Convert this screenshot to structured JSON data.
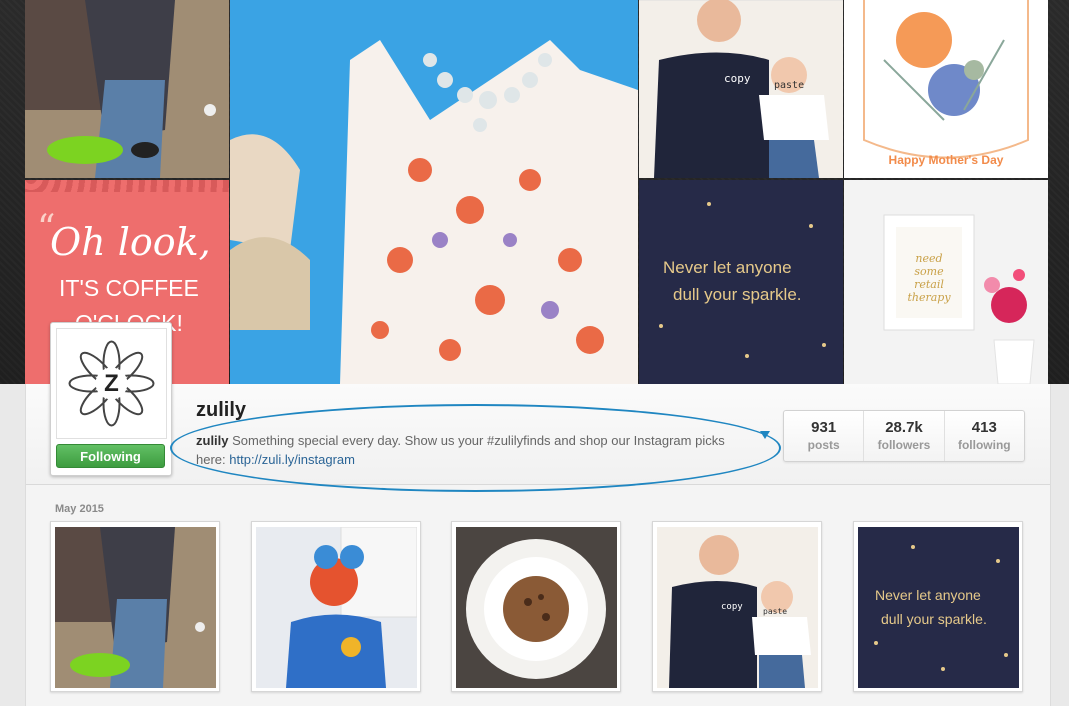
{
  "hero": {
    "coffee_line1": "Oh look,",
    "coffee_line2": "IT'S COFFEE",
    "coffee_line3": "O'CLOCK!",
    "shirt_copy": "copy",
    "shirt_paste": "paste",
    "mothers_day": "Happy Mother's Day",
    "sparkle_quote_1": "Never let anyone",
    "sparkle_quote_2": "dull your sparkle.",
    "frame_text": "need some retail therapy"
  },
  "profile": {
    "username": "zulily",
    "bio_name": "zulily",
    "bio_text": "Something special every day. Show us your #zulilyfinds and shop our Instagram picks here:",
    "bio_link": "http://zuli.ly/instagram",
    "avatar_letter": "Z",
    "follow_label": "Following",
    "stats": [
      {
        "value": "931",
        "label": "posts"
      },
      {
        "value": "28.7k",
        "label": "followers"
      },
      {
        "value": "413",
        "label": "following"
      }
    ]
  },
  "grid": {
    "month_label": "May 2015",
    "thumb5_quote_1": "Never let anyone",
    "thumb5_quote_2": "dull your sparkle.",
    "thumb4_copy": "copy",
    "thumb4_paste": "paste"
  },
  "colors": {
    "follow_green": "#4caf50",
    "annotation_blue": "#1f86c1",
    "navy": "#262a48",
    "coral": "#ef6b6b"
  }
}
